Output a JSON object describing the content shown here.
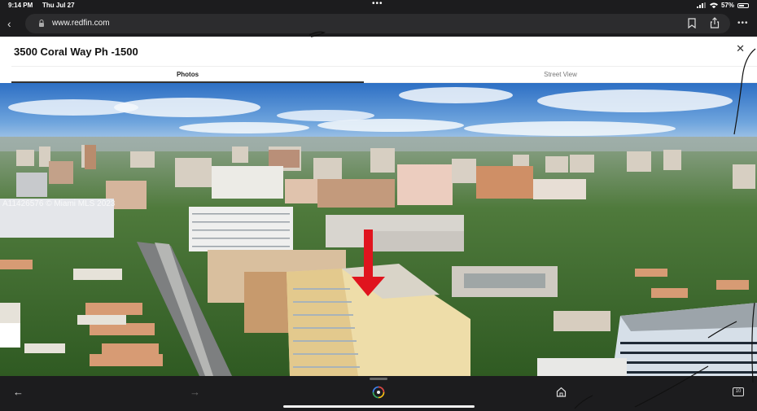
{
  "status": {
    "time": "9:14 PM",
    "date": "Thu Jul 27",
    "battery": "57%",
    "battery_level": 0.57
  },
  "browser": {
    "url": "www.redfin.com"
  },
  "listing": {
    "title": "3500 Coral Way Ph -1500"
  },
  "tabs": [
    {
      "label": "Photos",
      "active": true
    },
    {
      "label": "Street View",
      "active": false
    }
  ],
  "photo": {
    "watermark": "A11426576 © Miami MLS 2023"
  },
  "toolbar": {
    "tab_count": "10"
  },
  "colors": {
    "accent_arrow": "#e0141e",
    "ui_dark": "#1c1c1e"
  }
}
